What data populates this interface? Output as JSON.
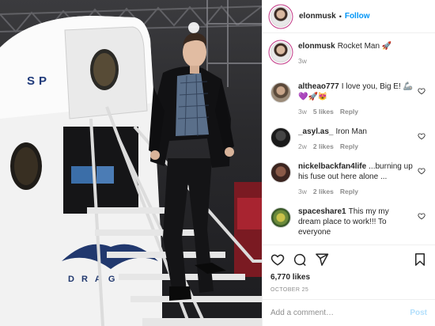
{
  "post": {
    "author": "elonmusk",
    "follow_label": "Follow",
    "caption_user": "elonmusk",
    "caption_text": "Rocket Man 🚀",
    "caption_age": "3w",
    "capsule_text_top": "SP",
    "capsule_text_bottom": "DRAG"
  },
  "comments": [
    {
      "user": "altheao777",
      "text": "I love you, Big E! 🦾💜🚀😻",
      "age": "3w",
      "likes": "5 likes",
      "reply": "Reply"
    },
    {
      "user": "_asyl.as_",
      "text": "Iron Man",
      "age": "2w",
      "likes": "2 likes",
      "reply": "Reply"
    },
    {
      "user": "nickelbackfan4life",
      "text": "...burning up his fuse out here alone ...",
      "age": "3w",
      "likes": "2 likes",
      "reply": "Reply"
    },
    {
      "user": "spaceshare1",
      "text": "This my my dream place to work!!! To everyone",
      "age": "",
      "likes": "",
      "reply": ""
    }
  ],
  "stats": {
    "likes": "6,770 likes",
    "date": "OCTOBER 25"
  },
  "composer": {
    "placeholder": "Add a comment…",
    "post_label": "Post"
  },
  "icons": [
    "heart-icon",
    "comment-icon",
    "share-icon",
    "bookmark-icon",
    "rocket-emoji"
  ],
  "colors": {
    "follow": "#0095f6",
    "post_disabled": "#b2dffc",
    "muted": "#8e8e8e"
  }
}
